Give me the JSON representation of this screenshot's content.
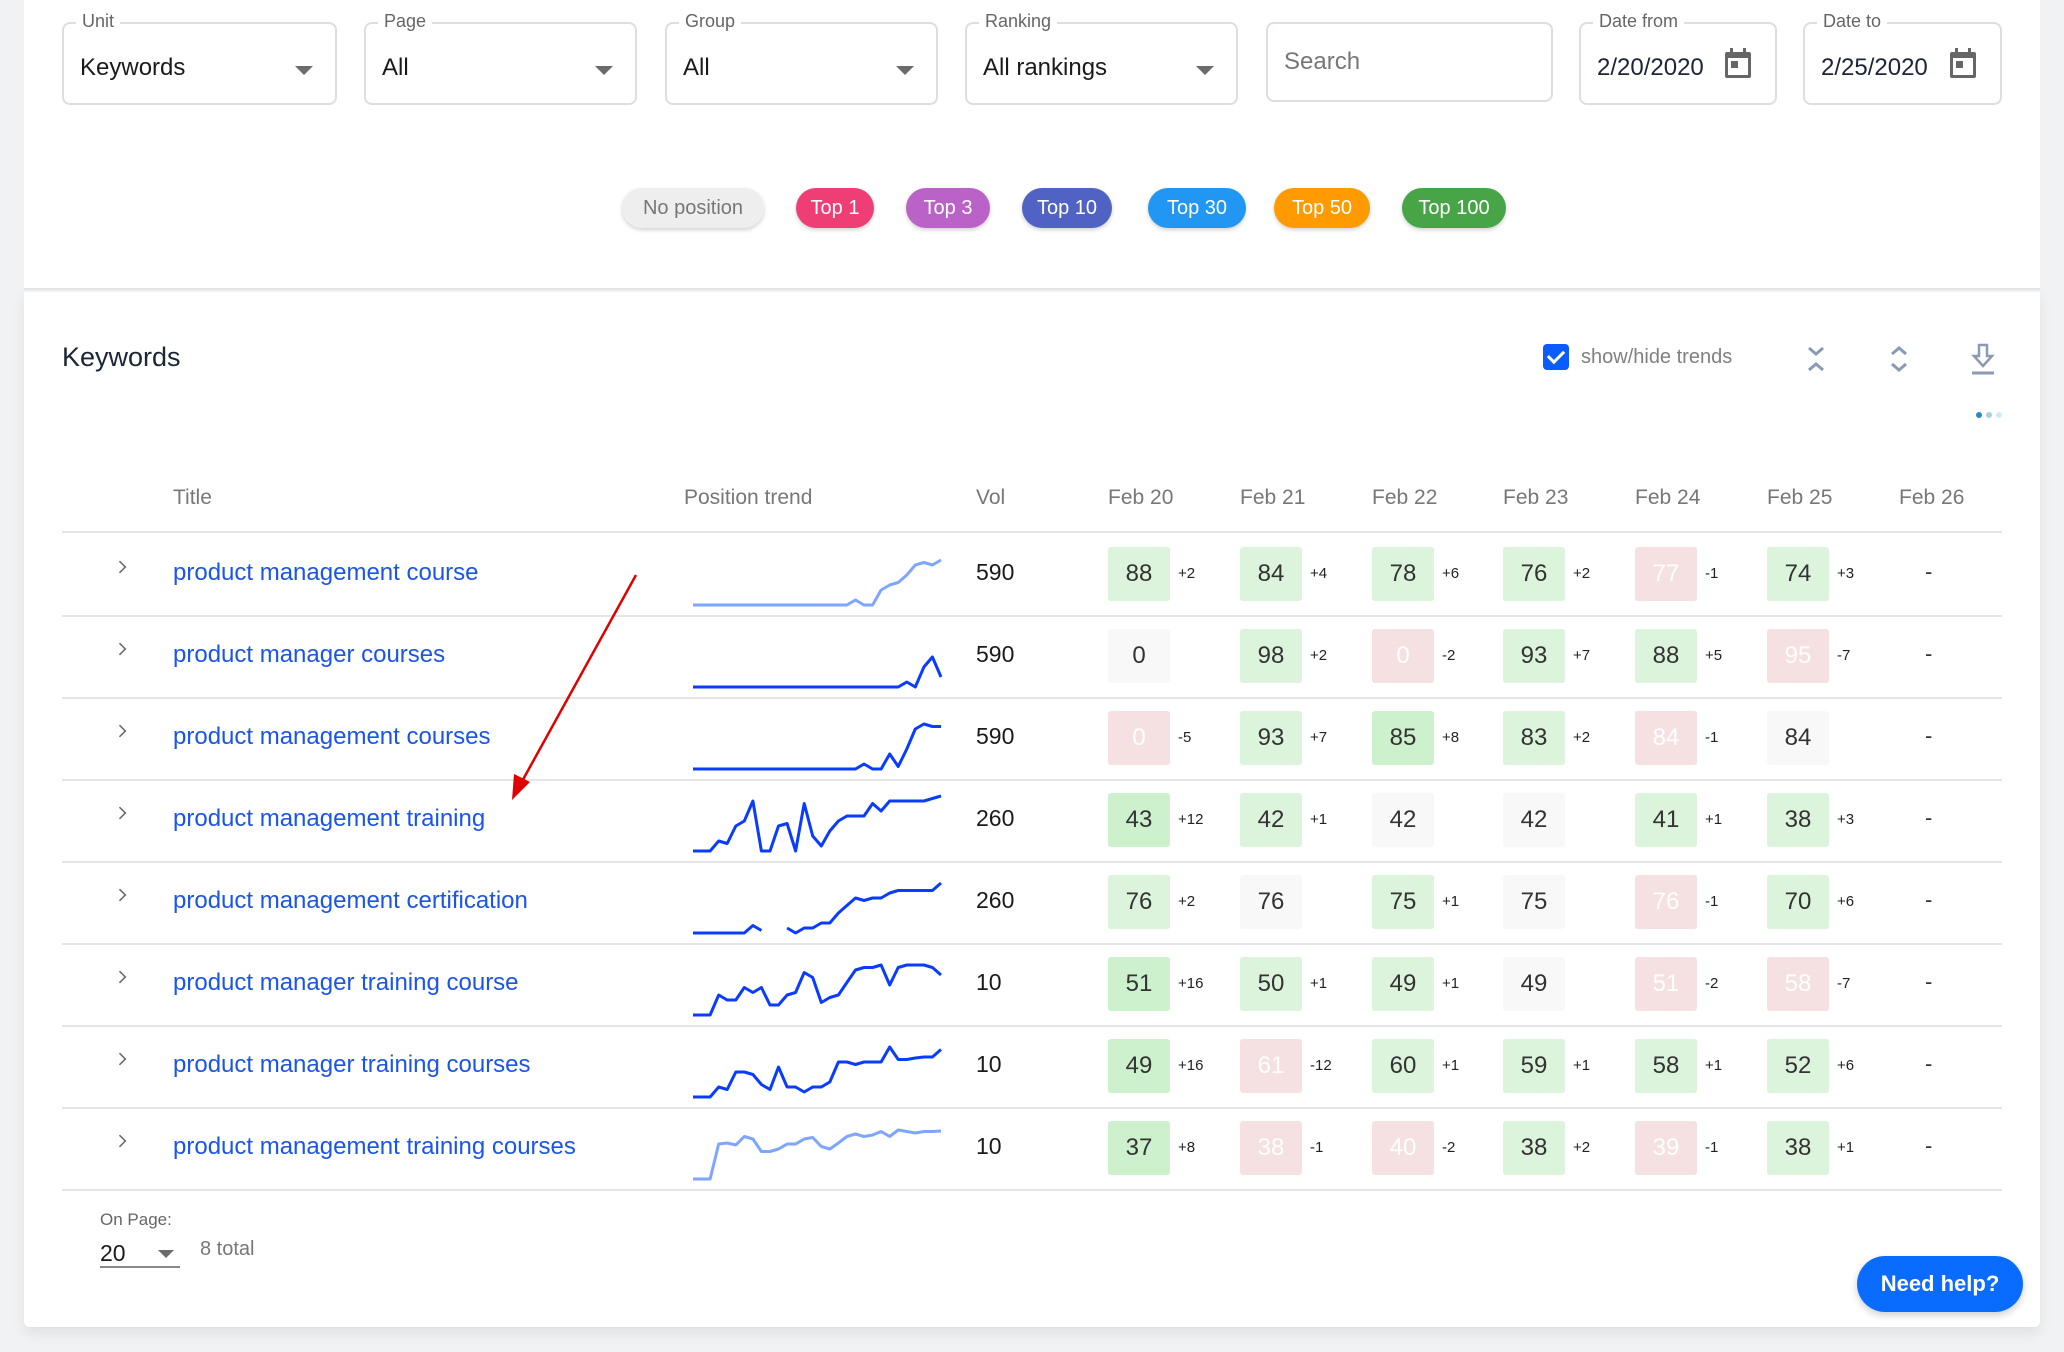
{
  "filters": {
    "unit": {
      "label": "Unit",
      "value": "Keywords"
    },
    "page": {
      "label": "Page",
      "value": "All"
    },
    "group": {
      "label": "Group",
      "value": "All"
    },
    "ranking": {
      "label": "Ranking",
      "value": "All rankings"
    },
    "search": {
      "placeholder": "Search",
      "value": ""
    },
    "date_from": {
      "label": "Date from",
      "value": "2/20/2020"
    },
    "date_to": {
      "label": "Date to",
      "value": "2/25/2020"
    }
  },
  "legend_chips": [
    {
      "label": "No position",
      "color": "#eeeeee",
      "text_color": "#777777"
    },
    {
      "label": "Top 1",
      "color": "#ef3e76",
      "text_color": "#ffffff"
    },
    {
      "label": "Top 3",
      "color": "#bb62c8",
      "text_color": "#ffffff"
    },
    {
      "label": "Top 10",
      "color": "#5162c5",
      "text_color": "#ffffff"
    },
    {
      "label": "Top 30",
      "color": "#2196f3",
      "text_color": "#ffffff"
    },
    {
      "label": "Top 50",
      "color": "#ff9a00",
      "text_color": "#ffffff"
    },
    {
      "label": "Top 100",
      "color": "#47a447",
      "text_color": "#ffffff"
    }
  ],
  "section": {
    "title": "Keywords",
    "show_trends_label": "show/hide trends",
    "show_trends_checked": true,
    "icons": [
      "collapse-all-icon",
      "expand-all-icon",
      "download-icon"
    ]
  },
  "table": {
    "headers": {
      "title": "Title",
      "trend": "Position trend",
      "vol": "Vol",
      "dates": [
        "Feb 20",
        "Feb 21",
        "Feb 22",
        "Feb 23",
        "Feb 24",
        "Feb 25",
        "Feb 26"
      ]
    },
    "rows": [
      {
        "keyword": "product management course",
        "vol": "590",
        "trend_style": "light",
        "trend": [
          0,
          0,
          0,
          0,
          0,
          0,
          0,
          0,
          0,
          0,
          0,
          0,
          0,
          0,
          0,
          0,
          0,
          0,
          0,
          0.1,
          0,
          0,
          0.3,
          0.4,
          0.45,
          0.6,
          0.8,
          0.85,
          0.8,
          0.9
        ],
        "cells": [
          {
            "v": "88",
            "d": "+2",
            "s": "up"
          },
          {
            "v": "84",
            "d": "+4",
            "s": "up"
          },
          {
            "v": "78",
            "d": "+6",
            "s": "up"
          },
          {
            "v": "76",
            "d": "+2",
            "s": "up"
          },
          {
            "v": "77",
            "d": "-1",
            "s": "down"
          },
          {
            "v": "74",
            "d": "+3",
            "s": "up"
          },
          {
            "v": "-",
            "d": "",
            "s": "none"
          }
        ]
      },
      {
        "keyword": "product manager courses",
        "vol": "590",
        "trend_style": "dark",
        "trend": [
          0,
          0,
          0,
          0,
          0,
          0,
          0,
          0,
          0,
          0,
          0,
          0,
          0,
          0,
          0,
          0,
          0,
          0,
          0,
          0,
          0,
          0,
          0,
          0,
          0,
          0.1,
          0,
          0.4,
          0.6,
          0.2
        ],
        "cells": [
          {
            "v": "0",
            "d": "",
            "s": "flat"
          },
          {
            "v": "98",
            "d": "+2",
            "s": "up"
          },
          {
            "v": "0",
            "d": "-2",
            "s": "down"
          },
          {
            "v": "93",
            "d": "+7",
            "s": "up"
          },
          {
            "v": "88",
            "d": "+5",
            "s": "up"
          },
          {
            "v": "95",
            "d": "-7",
            "s": "down"
          },
          {
            "v": "-",
            "d": "",
            "s": "none"
          }
        ]
      },
      {
        "keyword": "product management courses",
        "vol": "590",
        "trend_style": "dark",
        "trend": [
          0,
          0,
          0,
          0,
          0,
          0,
          0,
          0,
          0,
          0,
          0,
          0,
          0,
          0,
          0,
          0,
          0,
          0,
          0,
          0,
          0.1,
          0,
          0,
          0.3,
          0.05,
          0.4,
          0.8,
          0.9,
          0.85,
          0.85
        ],
        "cells": [
          {
            "v": "0",
            "d": "-5",
            "s": "down"
          },
          {
            "v": "93",
            "d": "+7",
            "s": "up"
          },
          {
            "v": "85",
            "d": "+8",
            "s": "up"
          },
          {
            "v": "83",
            "d": "+2",
            "s": "up"
          },
          {
            "v": "84",
            "d": "-1",
            "s": "down"
          },
          {
            "v": "84",
            "d": "",
            "s": "flat"
          },
          {
            "v": "-",
            "d": "",
            "s": "none"
          }
        ]
      },
      {
        "keyword": "product management training",
        "vol": "260",
        "trend_style": "dark",
        "trend": [
          0,
          0,
          0,
          0.2,
          0.15,
          0.5,
          0.6,
          1.0,
          0,
          0,
          0.5,
          0.55,
          0,
          0.95,
          0.3,
          0.1,
          0.4,
          0.6,
          0.7,
          0.7,
          0.7,
          0.95,
          0.8,
          1.0,
          1.0,
          1.0,
          1.0,
          1.0,
          1.05,
          1.1
        ],
        "cells": [
          {
            "v": "43",
            "d": "+12",
            "s": "up"
          },
          {
            "v": "42",
            "d": "+1",
            "s": "up"
          },
          {
            "v": "42",
            "d": "",
            "s": "flat"
          },
          {
            "v": "42",
            "d": "",
            "s": "flat"
          },
          {
            "v": "41",
            "d": "+1",
            "s": "up"
          },
          {
            "v": "38",
            "d": "+3",
            "s": "up"
          },
          {
            "v": "-",
            "d": "",
            "s": "none"
          }
        ]
      },
      {
        "keyword": "product management certification",
        "vol": "260",
        "trend_style": "dark",
        "trend": [
          0,
          0,
          0,
          0,
          0,
          0,
          0,
          0.15,
          0.05,
          null,
          null,
          0.1,
          0,
          0.1,
          0.1,
          0.2,
          0.2,
          0.4,
          0.55,
          0.7,
          0.65,
          0.7,
          0.7,
          0.8,
          0.85,
          0.85,
          0.85,
          0.85,
          0.85,
          1.0
        ],
        "cells": [
          {
            "v": "76",
            "d": "+2",
            "s": "up"
          },
          {
            "v": "76",
            "d": "",
            "s": "flat"
          },
          {
            "v": "75",
            "d": "+1",
            "s": "up"
          },
          {
            "v": "75",
            "d": "",
            "s": "flat"
          },
          {
            "v": "76",
            "d": "-1",
            "s": "down"
          },
          {
            "v": "70",
            "d": "+6",
            "s": "up"
          },
          {
            "v": "-",
            "d": "",
            "s": "none"
          }
        ]
      },
      {
        "keyword": "product manager training course",
        "vol": "10",
        "trend_style": "dark",
        "trend": [
          0,
          0,
          0,
          0.4,
          0.3,
          0.3,
          0.55,
          0.45,
          0.55,
          0.2,
          0.2,
          0.4,
          0.45,
          0.85,
          0.75,
          0.25,
          0.35,
          0.4,
          0.65,
          0.9,
          0.95,
          0.95,
          1.0,
          0.6,
          0.95,
          1.0,
          1.0,
          1.0,
          0.95,
          0.8
        ],
        "cells": [
          {
            "v": "51",
            "d": "+16",
            "s": "up"
          },
          {
            "v": "50",
            "d": "+1",
            "s": "up"
          },
          {
            "v": "49",
            "d": "+1",
            "s": "up"
          },
          {
            "v": "49",
            "d": "",
            "s": "flat"
          },
          {
            "v": "51",
            "d": "-2",
            "s": "down"
          },
          {
            "v": "58",
            "d": "-7",
            "s": "down"
          },
          {
            "v": "-",
            "d": "",
            "s": "none"
          }
        ]
      },
      {
        "keyword": "product manager training courses",
        "vol": "10",
        "trend_style": "dark",
        "trend": [
          0,
          0,
          0,
          0.2,
          0.15,
          0.5,
          0.5,
          0.45,
          0.25,
          0.15,
          0.6,
          0.2,
          0.2,
          0.1,
          0.2,
          0.2,
          0.3,
          0.7,
          0.7,
          0.65,
          0.7,
          0.7,
          0.7,
          1.0,
          0.75,
          0.75,
          0.78,
          0.8,
          0.8,
          0.95
        ],
        "cells": [
          {
            "v": "49",
            "d": "+16",
            "s": "up"
          },
          {
            "v": "61",
            "d": "-12",
            "s": "down"
          },
          {
            "v": "60",
            "d": "+1",
            "s": "up"
          },
          {
            "v": "59",
            "d": "+1",
            "s": "up"
          },
          {
            "v": "58",
            "d": "+1",
            "s": "up"
          },
          {
            "v": "52",
            "d": "+6",
            "s": "up"
          },
          {
            "v": "-",
            "d": "",
            "s": "none"
          }
        ]
      },
      {
        "keyword": "product management training courses",
        "vol": "10",
        "trend_style": "light",
        "trend": [
          0,
          0,
          0,
          0.7,
          0.72,
          0.68,
          0.85,
          0.8,
          0.55,
          0.55,
          0.6,
          0.7,
          0.7,
          0.8,
          0.83,
          0.65,
          0.6,
          0.72,
          0.85,
          0.9,
          0.85,
          0.88,
          0.95,
          0.85,
          0.98,
          0.95,
          0.92,
          0.95,
          0.95,
          0.96
        ],
        "cells": [
          {
            "v": "37",
            "d": "+8",
            "s": "up"
          },
          {
            "v": "38",
            "d": "-1",
            "s": "down"
          },
          {
            "v": "40",
            "d": "-2",
            "s": "down"
          },
          {
            "v": "38",
            "d": "+2",
            "s": "up"
          },
          {
            "v": "39",
            "d": "-1",
            "s": "down"
          },
          {
            "v": "38",
            "d": "+1",
            "s": "up"
          },
          {
            "v": "-",
            "d": "",
            "s": "none"
          }
        ]
      }
    ]
  },
  "pagination": {
    "on_page_label": "On Page:",
    "per_page": "20",
    "total": "8 total"
  },
  "help_button": "Need help?",
  "colors": {
    "link": "#1b55e8",
    "up_bg": "#dcf3dc",
    "up_strong_bg": "#cdf0cd",
    "down_bg": "#f5e1e1",
    "flat_bg": "#f8f8f8",
    "trend_dark": "#0a3cff",
    "trend_light": "#7fa6ff",
    "annotation_arrow": "#e00000"
  }
}
